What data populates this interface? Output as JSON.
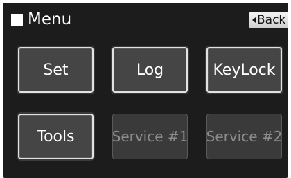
{
  "header": {
    "menu_icon": "white-square-icon",
    "title": "Menu",
    "back_icon": "back-arrow-icon",
    "back_label": "Back"
  },
  "buttons": [
    {
      "label": "Set",
      "enabled": true
    },
    {
      "label": "Log",
      "enabled": true
    },
    {
      "label": "KeyLock",
      "enabled": true
    },
    {
      "label": "Tools",
      "enabled": true
    },
    {
      "label": "Service #1",
      "enabled": false
    },
    {
      "label": "Service #2",
      "enabled": false
    }
  ],
  "colors": {
    "screen_background": "#1c1c1c",
    "button_active": "#454545",
    "button_disabled": "#3a3a3a",
    "text_disabled": "#8c8c8c"
  }
}
